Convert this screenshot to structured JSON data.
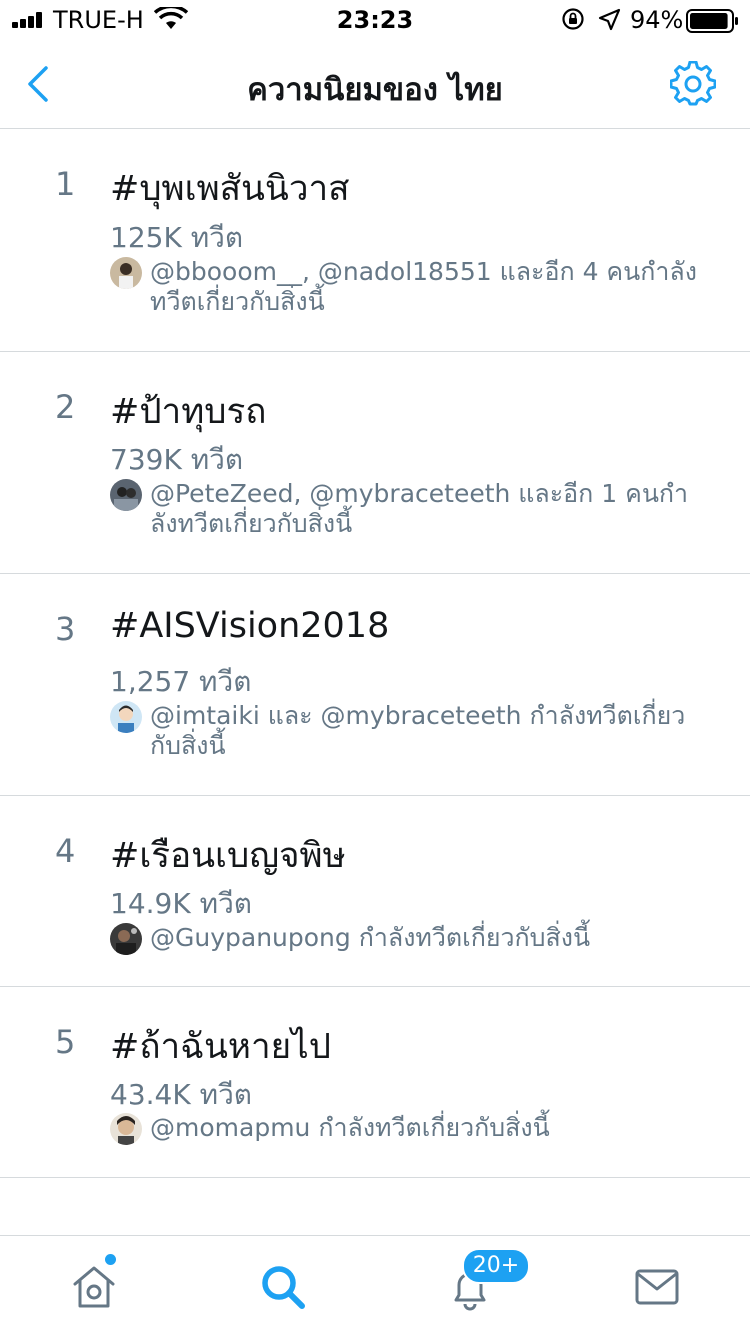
{
  "status_bar": {
    "carrier": "TRUE-H",
    "time": "23:23",
    "battery_percent": "94%",
    "battery_level": 0.94
  },
  "header": {
    "title": "ความนิยมของ ไทย",
    "back_icon": "chevron-left-icon",
    "settings_icon": "gear-icon"
  },
  "colors": {
    "accent": "#1da1f2",
    "text": "#14171a",
    "secondary": "#657786",
    "divider": "#d6dadd"
  },
  "trends": [
    {
      "rank": "1",
      "hashtag": "#บุพเพสันนิวาส",
      "tweet_count": "125K ทวีต",
      "context": "@bbooom__, @nadol18551 และอีก 4 คนกำลังทวีตเกี่ยวกับสิ่งนี้"
    },
    {
      "rank": "2",
      "hashtag": "#ป้าทุบรถ",
      "tweet_count": "739K ทวีต",
      "context": "@PeteZeed, @mybraceteeth และอีก 1 คนกำลังทวีตเกี่ยวกับสิ่งนี้"
    },
    {
      "rank": "3",
      "hashtag": "#AISVision2018",
      "tweet_count": "1,257 ทวีต",
      "context": "@imtaiki และ @mybraceteeth กำลังทวีตเกี่ยวกับสิ่งนี้"
    },
    {
      "rank": "4",
      "hashtag": "#เรือนเบญจพิษ",
      "tweet_count": "14.9K ทวีต",
      "context": "@Guypanupong กำลังทวีตเกี่ยวกับสิ่งนี้"
    },
    {
      "rank": "5",
      "hashtag": "#ถ้าฉันหายไป",
      "tweet_count": "43.4K ทวีต",
      "context": "@momapmu กำลังทวีตเกี่ยวกับสิ่งนี้"
    }
  ],
  "tabbar": {
    "home_icon": "home-icon",
    "search_icon": "search-icon",
    "notifications_icon": "bell-icon",
    "notifications_badge": "20+",
    "messages_icon": "mail-icon"
  }
}
